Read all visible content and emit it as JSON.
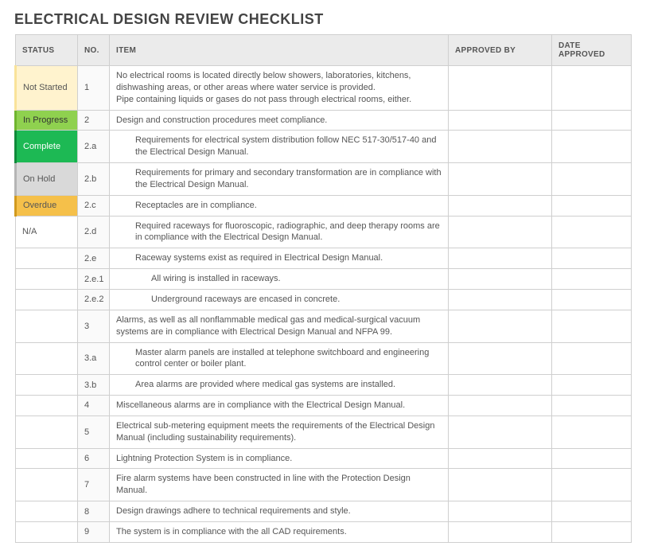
{
  "title": "ELECTRICAL DESIGN REVIEW CHECKLIST",
  "headers": {
    "status": "STATUS",
    "no": "NO.",
    "item": "ITEM",
    "approved_by": "APPROVED BY",
    "date_approved": "DATE APPROVED"
  },
  "rows": [
    {
      "status": "Not Started",
      "status_class": "sw-notstarted",
      "no": "1",
      "indent": 0,
      "item": "No electrical rooms is located directly below showers, laboratories, kitchens, dishwashing areas, or other areas where water service is provided.\nPipe containing liquids or gases do not pass through electrical rooms, either.",
      "approved_by": "",
      "date_approved": ""
    },
    {
      "status": "In Progress",
      "status_class": "sw-inprogress",
      "no": "2",
      "indent": 0,
      "item": "Design and construction procedures meet compliance.",
      "approved_by": "",
      "date_approved": ""
    },
    {
      "status": "Complete",
      "status_class": "sw-complete",
      "no": "2.a",
      "indent": 1,
      "item": "Requirements for electrical system distribution follow NEC 517-30/517-40 and the Electrical Design Manual.",
      "approved_by": "",
      "date_approved": ""
    },
    {
      "status": "On Hold",
      "status_class": "sw-onhold",
      "no": "2.b",
      "indent": 1,
      "item": "Requirements for primary and secondary transformation are in compliance with the Electrical Design Manual.",
      "approved_by": "",
      "date_approved": ""
    },
    {
      "status": "Overdue",
      "status_class": "sw-overdue",
      "no": "2.c",
      "indent": 1,
      "item": "Receptacles are in compliance.",
      "approved_by": "",
      "date_approved": ""
    },
    {
      "status": "N/A",
      "status_class": "sw-na",
      "no": "2.d",
      "indent": 1,
      "item": "Required raceways for fluoroscopic, radiographic, and deep therapy rooms are in compliance with the Electrical Design Manual.",
      "approved_by": "",
      "date_approved": ""
    },
    {
      "status": "",
      "status_class": "",
      "no": "2.e",
      "indent": 1,
      "item": "Raceway systems exist as required in Electrical Design Manual.",
      "approved_by": "",
      "date_approved": ""
    },
    {
      "status": "",
      "status_class": "",
      "no": "2.e.1",
      "indent": 2,
      "item": "All wiring is installed in raceways.",
      "approved_by": "",
      "date_approved": ""
    },
    {
      "status": "",
      "status_class": "",
      "no": "2.e.2",
      "indent": 2,
      "item": "Underground raceways are encased in concrete.",
      "approved_by": "",
      "date_approved": ""
    },
    {
      "status": "",
      "status_class": "",
      "no": "3",
      "indent": 0,
      "item": "Alarms, as well as all nonflammable medical gas and medical-surgical vacuum systems are in compliance with Electrical Design Manual and NFPA 99.",
      "approved_by": "",
      "date_approved": ""
    },
    {
      "status": "",
      "status_class": "",
      "no": "3.a",
      "indent": 1,
      "item": "Master alarm panels are installed at telephone switchboard and engineering control center or boiler plant.",
      "approved_by": "",
      "date_approved": ""
    },
    {
      "status": "",
      "status_class": "",
      "no": "3.b",
      "indent": 1,
      "item": "Area alarms are provided where medical gas systems are installed.",
      "approved_by": "",
      "date_approved": ""
    },
    {
      "status": "",
      "status_class": "",
      "no": "4",
      "indent": 0,
      "item": "Miscellaneous alarms are in compliance with the Electrical Design Manual.",
      "approved_by": "",
      "date_approved": ""
    },
    {
      "status": "",
      "status_class": "",
      "no": "5",
      "indent": 0,
      "item": "Electrical sub-metering equipment meets the requirements of the Electrical Design Manual (including sustainability requirements).",
      "approved_by": "",
      "date_approved": ""
    },
    {
      "status": "",
      "status_class": "",
      "no": "6",
      "indent": 0,
      "item": "Lightning Protection System is in compliance.",
      "approved_by": "",
      "date_approved": ""
    },
    {
      "status": "",
      "status_class": "",
      "no": "7",
      "indent": 0,
      "item": "Fire alarm systems have been constructed in line with the Protection Design Manual.",
      "approved_by": "",
      "date_approved": ""
    },
    {
      "status": "",
      "status_class": "",
      "no": "8",
      "indent": 0,
      "item": "Design drawings adhere to technical requirements and style.",
      "approved_by": "",
      "date_approved": ""
    },
    {
      "status": "",
      "status_class": "",
      "no": "9",
      "indent": 0,
      "item": "The system is in compliance with the all CAD requirements.",
      "approved_by": "",
      "date_approved": ""
    }
  ]
}
